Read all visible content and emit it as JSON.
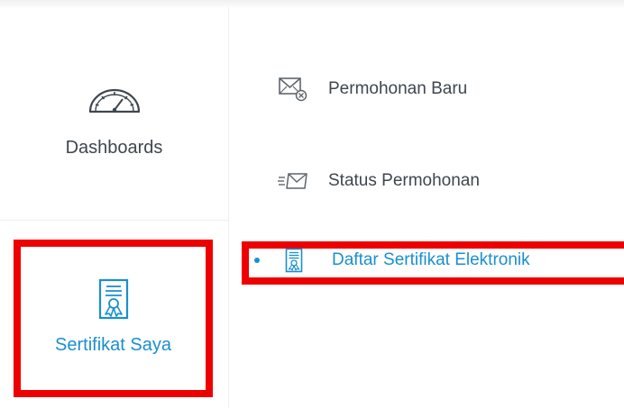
{
  "sidebar": {
    "items": [
      {
        "label": "Dashboards",
        "icon": "gauge-icon",
        "active": false
      },
      {
        "label": "Sertifikat Saya",
        "icon": "certificate-icon",
        "active": true
      }
    ]
  },
  "submenu": {
    "items": [
      {
        "label": "Permohonan Baru",
        "icon": "envelope-new-icon",
        "active": false
      },
      {
        "label": "Status Permohonan",
        "icon": "envelope-status-icon",
        "active": false
      },
      {
        "label": "Daftar Sertifikat Elektronik",
        "icon": "certificate-icon",
        "active": true
      }
    ]
  },
  "colors": {
    "accent": "#1a8fd0",
    "text": "#3e4650",
    "highlight_border": "#ee0000",
    "divider": "#eceff2"
  }
}
